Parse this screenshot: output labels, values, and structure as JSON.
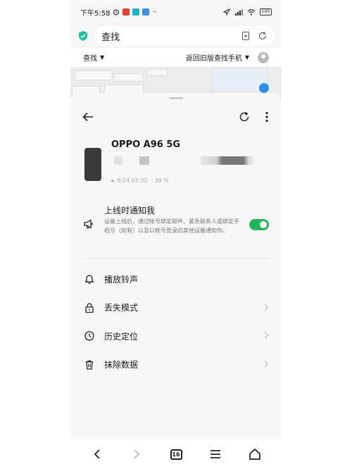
{
  "status_bar": {
    "time": "下午5:58",
    "more": "··",
    "battery": "100"
  },
  "browser": {
    "page_title": "查找"
  },
  "web_header": {
    "left_label": "查找",
    "old_version_label": "返回旧版查找手机"
  },
  "device": {
    "name": "OPPO A96 5G",
    "last_seen": "9/24 02:30",
    "battery_text": "38 %"
  },
  "notify": {
    "title": "上线时通知我",
    "description": "设备上线后，通过帐号绑定邮件、紧急联系人或绑定手机号（如有）以及以帐号登录的其他设备通知你。",
    "enabled": true
  },
  "menu": {
    "items": [
      {
        "label": "播放铃声",
        "icon": "bell-icon",
        "has_arrow": false
      },
      {
        "label": "丢失模式",
        "icon": "lock-icon",
        "has_arrow": true
      },
      {
        "label": "历史定位",
        "icon": "location-icon",
        "has_arrow": true
      },
      {
        "label": "抹除数据",
        "icon": "trash-icon",
        "has_arrow": true
      }
    ]
  },
  "nav": {
    "tab_count": "16"
  },
  "colors": {
    "toggle_on": "#23b45a",
    "shield": "#1fc2a0",
    "map_pin": "#2c8ff0"
  }
}
